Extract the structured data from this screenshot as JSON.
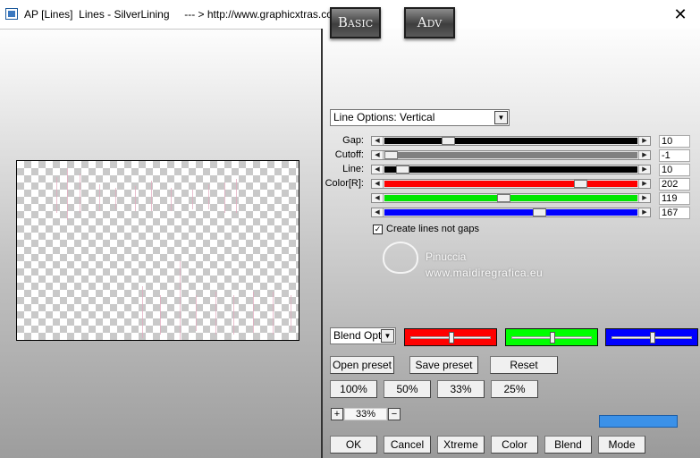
{
  "window": {
    "title": "AP [Lines]  Lines - SilverLining     --- > http://www.graphicxtras.com",
    "close_glyph": "✕"
  },
  "modes": {
    "basic": "Basic",
    "adv": "Adv"
  },
  "line_options": {
    "selected": "Line Options: Vertical"
  },
  "sliders": [
    {
      "label": "Gap:",
      "value": "10",
      "fill": "#000000",
      "position": 0.24
    },
    {
      "label": "Cutoff:",
      "value": "-1",
      "fill": "#808080",
      "position": 0.0
    },
    {
      "label": "Line:",
      "value": "10",
      "fill": "#000000",
      "position": 0.05,
      "partial": 0.025
    },
    {
      "label": "Color[R]:",
      "value": "202",
      "fill": "#ff0000",
      "position": 0.79
    },
    {
      "label": "",
      "value": "119",
      "fill": "#00e600",
      "position": 0.47
    },
    {
      "label": "",
      "value": "167",
      "fill": "#0000ff",
      "position": 0.62
    }
  ],
  "checkbox": {
    "label": "Create lines not gaps",
    "checked": true,
    "mark": "✓"
  },
  "watermark": {
    "name": "Pinuccia",
    "url": "www.maidiregrafica.eu"
  },
  "blend": {
    "select": "Blend Optio",
    "boxes": [
      {
        "color": "#ff0000",
        "position": 0.5
      },
      {
        "color": "#00ff00",
        "position": 0.5
      },
      {
        "color": "#0000ff",
        "position": 0.5
      }
    ]
  },
  "presets": {
    "open": "Open preset",
    "save": "Save preset",
    "reset": "Reset"
  },
  "zoom_buttons": [
    "100%",
    "50%",
    "33%",
    "25%"
  ],
  "zoom": {
    "plus": "+",
    "value": "33%",
    "minus": "−"
  },
  "swatch_color": "#3b91e8",
  "actions": {
    "ok": "OK",
    "cancel": "Cancel",
    "xtreme": "Xtreme",
    "color": "Color",
    "blend": "Blend",
    "mode": "Mode"
  },
  "icons": {
    "app": "app-icon",
    "close": "close-icon",
    "dropdown": "chevron-down-icon",
    "arrow_left": "arrow-left-icon",
    "arrow_right": "arrow-right-icon"
  }
}
